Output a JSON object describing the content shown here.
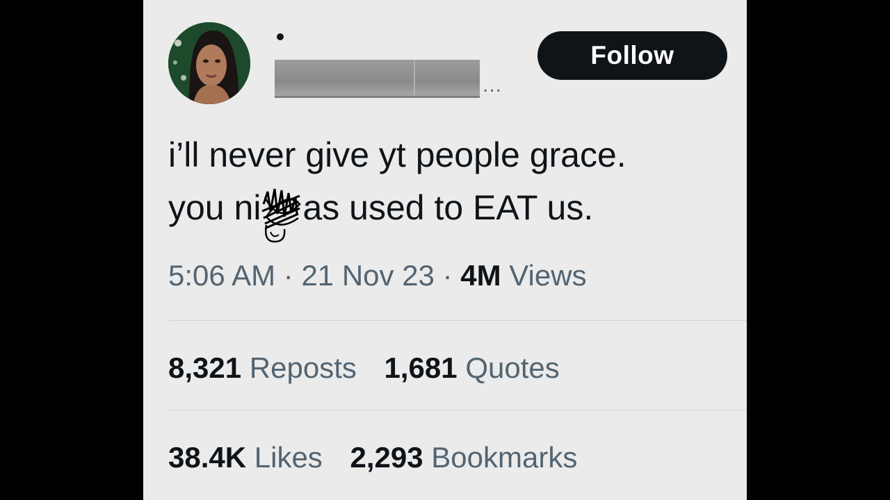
{
  "tweet": {
    "follow_label": "Follow",
    "name_truncation": "...",
    "text_line_1": "i’ll never give yt people grace.",
    "text_line_2_before": "you ni",
    "text_line_2_after": "as used to EAT us.",
    "time": "5:06 AM",
    "date": "21 Nov 23",
    "separator": "·",
    "views_count": "4M",
    "views_label": "Views"
  },
  "stats": {
    "reposts_count": "8,321",
    "reposts_label": "Reposts",
    "quotes_count": "1,681",
    "quotes_label": "Quotes",
    "likes_count": "38.4K",
    "likes_label": "Likes",
    "bookmarks_count": "2,293",
    "bookmarks_label": "Bookmarks"
  },
  "colors": {
    "card_background": "#ebebeb",
    "primary_text": "#0f1419",
    "secondary_text": "#536471",
    "follow_button": "#0f1419"
  }
}
